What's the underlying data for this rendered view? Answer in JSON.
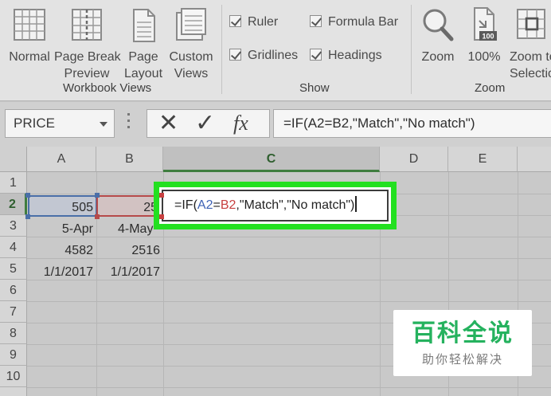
{
  "ribbon": {
    "workbook_views": {
      "label": "Workbook Views",
      "buttons": [
        {
          "line1": "Normal",
          "line2": ""
        },
        {
          "line1": "Page Break",
          "line2": "Preview"
        },
        {
          "line1": "Page",
          "line2": "Layout"
        },
        {
          "line1": "Custom",
          "line2": "Views"
        }
      ]
    },
    "show": {
      "label": "Show",
      "ruler": "Ruler",
      "formula_bar": "Formula Bar",
      "gridlines": "Gridlines",
      "headings": "Headings"
    },
    "zoom": {
      "label": "Zoom",
      "zoom_button": "Zoom",
      "hundred_button": "100%",
      "hundred_icon_text": "100",
      "zoom_to_line1": "Zoom to",
      "zoom_to_line2": "Selection"
    }
  },
  "formula_bar": {
    "name_box": "PRICE",
    "cancel_icon": "✕",
    "enter_icon": "✓",
    "fx_label": "fx",
    "formula": "=IF(A2=B2,\"Match\",\"No match\")"
  },
  "grid": {
    "columns": [
      "A",
      "B",
      "C",
      "D",
      "E"
    ],
    "rows": [
      "1",
      "2",
      "3",
      "4",
      "5",
      "6",
      "7",
      "8",
      "9",
      "10"
    ],
    "cells": {
      "A2": "505",
      "B2": "25",
      "A3": "5-Apr",
      "B3": "4-May",
      "A4": "4582",
      "B4": "2516",
      "A5": "1/1/2017",
      "B5": "1/1/2017"
    },
    "edit": {
      "prefix": "=IF(",
      "ref1": "A2",
      "op": "=",
      "ref2": "B2",
      "rest": ",\"Match\",\"No match\")"
    },
    "colors": {
      "highlight": "#23e020",
      "ref_a": "#3f63b5",
      "ref_b": "#c73f3f"
    }
  },
  "watermark": {
    "title": "百科全说",
    "subtitle": "助你轻松解决"
  }
}
